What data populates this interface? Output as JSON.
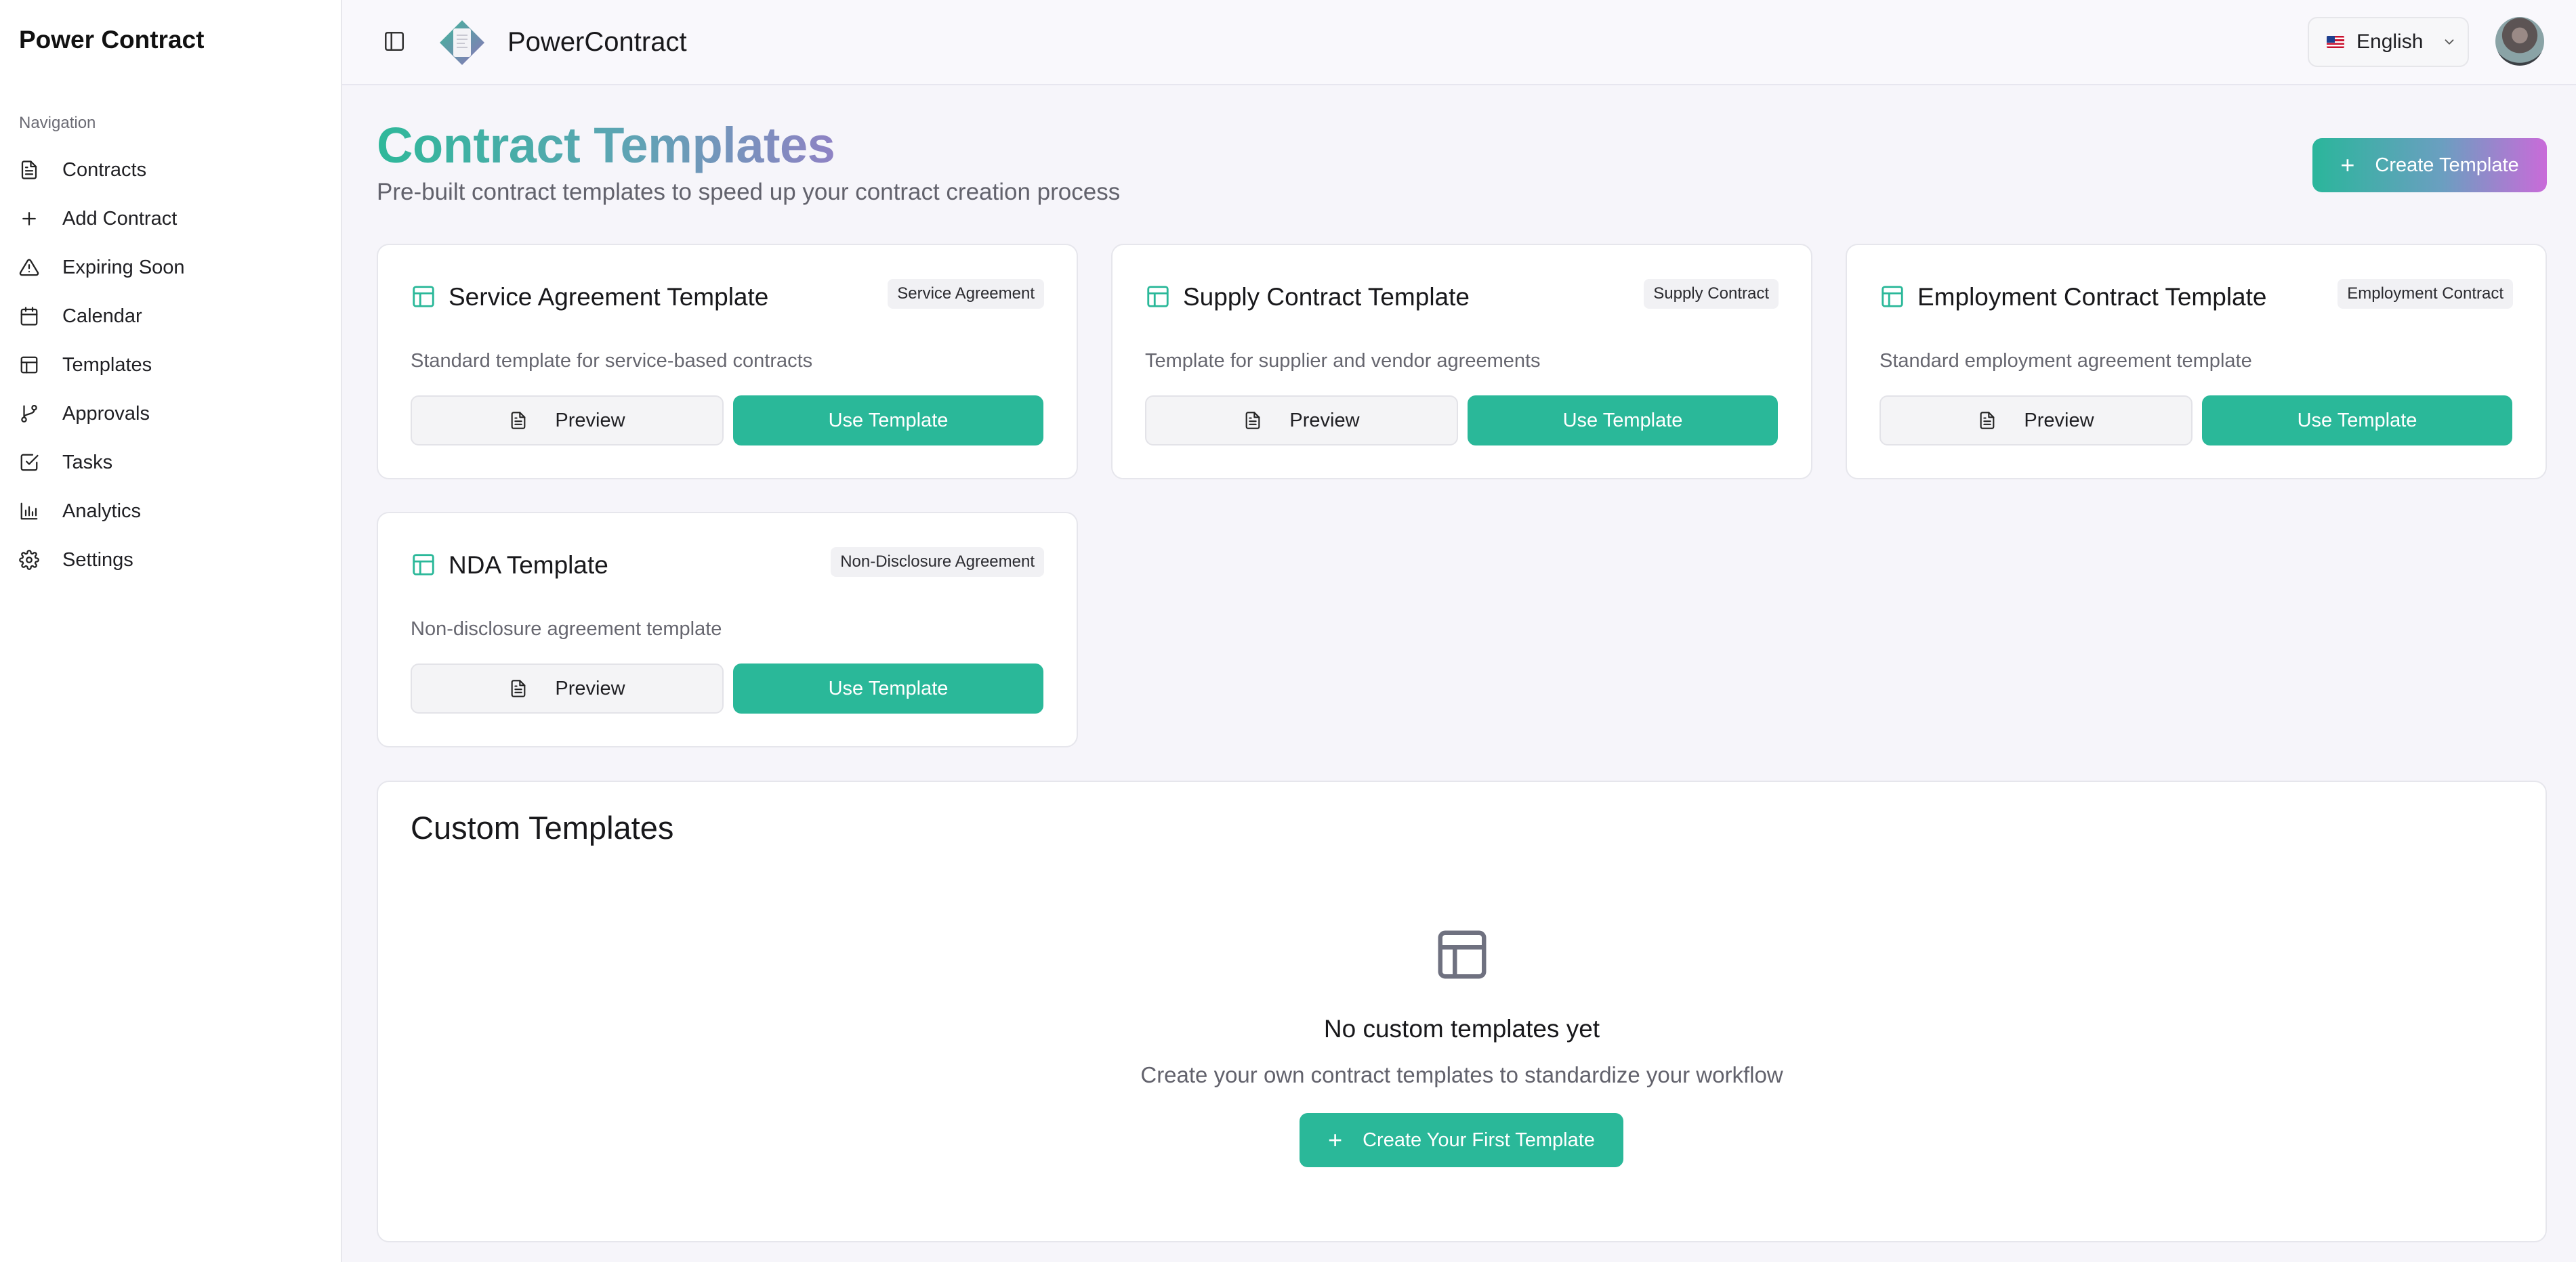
{
  "sidebar": {
    "brand": "Power Contract",
    "heading": "Navigation",
    "items": [
      {
        "label": "Contracts",
        "icon": "file-text-icon"
      },
      {
        "label": "Add Contract",
        "icon": "plus-icon"
      },
      {
        "label": "Expiring Soon",
        "icon": "alert-triangle-icon"
      },
      {
        "label": "Calendar",
        "icon": "calendar-icon"
      },
      {
        "label": "Templates",
        "icon": "layout-icon"
      },
      {
        "label": "Approvals",
        "icon": "git-branch-icon"
      },
      {
        "label": "Tasks",
        "icon": "check-square-icon"
      },
      {
        "label": "Analytics",
        "icon": "bar-chart-icon"
      },
      {
        "label": "Settings",
        "icon": "gear-icon"
      }
    ]
  },
  "topbar": {
    "app_name": "PowerContract",
    "language": "English"
  },
  "header": {
    "title": "Contract Templates",
    "subtitle": "Pre-built contract templates to speed up your contract creation process",
    "create_label": "Create Template"
  },
  "templates": [
    {
      "title": "Service Agreement Template",
      "badge": "Service Agreement",
      "desc": "Standard template for service-based contracts",
      "preview": "Preview",
      "use": "Use Template"
    },
    {
      "title": "Supply Contract Template",
      "badge": "Supply Contract",
      "desc": "Template for supplier and vendor agreements",
      "preview": "Preview",
      "use": "Use Template"
    },
    {
      "title": "Employment Contract Template",
      "badge": "Employment Contract",
      "desc": "Standard employment agreement template",
      "preview": "Preview",
      "use": "Use Template"
    },
    {
      "title": "NDA Template",
      "badge": "Non-Disclosure Agreement",
      "desc": "Non-disclosure agreement template",
      "preview": "Preview",
      "use": "Use Template"
    }
  ],
  "custom": {
    "title": "Custom Templates",
    "empty_title": "No custom templates yet",
    "empty_sub": "Create your own contract templates to standardize your workflow",
    "button": "Create Your First Template"
  },
  "colors": {
    "accent": "#2ab899",
    "gradient_start": "#2fb89a",
    "gradient_end": "#c96bd9"
  }
}
